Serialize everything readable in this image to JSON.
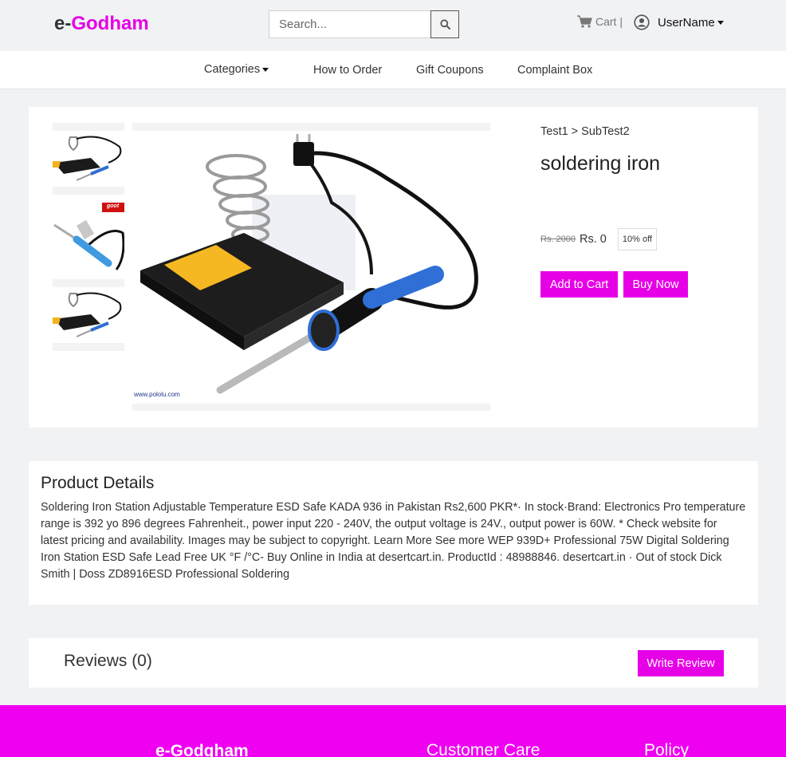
{
  "header": {
    "logo_prefix": "e-",
    "logo_name": "Godham",
    "search_placeholder": "Search...",
    "cart_label": "Cart |",
    "user_label": "UserName"
  },
  "nav": {
    "categories": "Categories",
    "how_to_order": "How to Order",
    "gift_coupons": "Gift Coupons",
    "complaint_box": "Complaint Box"
  },
  "product": {
    "breadcrumb": "Test1 > SubTest2",
    "title": "soldering iron",
    "old_price": "Rs. 2000",
    "price": "Rs. 0",
    "discount": "10% off",
    "add_to_cart": "Add to Cart",
    "buy_now": "Buy Now",
    "image_watermark": "www.pololu.com",
    "thumb_badge": "goot"
  },
  "details": {
    "title": "Product Details",
    "text": "Soldering Iron Station Adjustable Temperature ESD Safe KADA 936 in Pakistan Rs2,600 PKR*· In stock·Brand: Electronics Pro temperature range is 392 yo 896 degrees Fahrenheit., power input 220 - 240V, the output voltage is 24V., output power is 60W. * Check website for latest pricing and availability. Images may be subject to copyright. Learn More See more WEP 939D+ Professional 75W Digital Soldering Iron Station ESD Safe Lead Free UK °F /°C- Buy Online in India at desertcart.in. ProductId : 48988846. desertcart.in · Out of stock Dick Smith | Doss ZD8916ESD Professional Soldering"
  },
  "reviews": {
    "title": "Reviews (0)",
    "write_review": "Write Review"
  },
  "footer": {
    "brand": "e-Godgham",
    "customer_care": "Customer Care",
    "policy": "Policy"
  },
  "colors": {
    "accent": "#e600e6",
    "footer": "#f000f0",
    "background": "#f1f2f4"
  },
  "icons": [
    "search-icon",
    "cart-icon",
    "user-circle-icon",
    "caret-down-icon"
  ]
}
